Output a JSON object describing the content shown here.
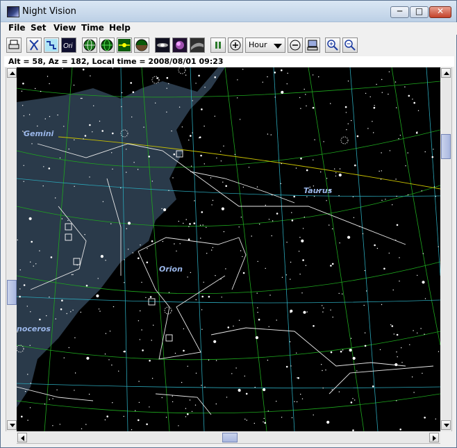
{
  "window": {
    "title": "Night Vision"
  },
  "window_controls": {
    "minimize": "─",
    "maximize": "□",
    "close": "✕"
  },
  "menu": [
    "File",
    "Set",
    "View",
    "Time",
    "Help"
  ],
  "toolbar": {
    "tools": [
      {
        "name": "print-icon"
      },
      {
        "name": "constellation-line-icon"
      },
      {
        "name": "constellation-boundary-icon"
      },
      {
        "name": "constellation-name-icon",
        "label": "Ori"
      },
      {
        "name": "equatorial-grid-icon"
      },
      {
        "name": "altaz-grid-icon"
      },
      {
        "name": "ecliptic-icon"
      },
      {
        "name": "horizon-icon"
      },
      {
        "name": "galaxy-icon"
      },
      {
        "name": "nebula-icon"
      },
      {
        "name": "milky-way-icon"
      },
      {
        "name": "pause-icon"
      },
      {
        "name": "step-forward-icon"
      },
      {
        "name": "step-back-icon"
      },
      {
        "name": "monitor-icon"
      },
      {
        "name": "zoom-in-icon"
      },
      {
        "name": "zoom-out-icon"
      }
    ],
    "time_step": "Hour"
  },
  "status": "Alt = 58, Az = 182, Local time = 2008/08/01 09:23",
  "sky": {
    "constellations": [
      "Gemini",
      "Taurus",
      "Orion",
      "Monoceros"
    ],
    "constellation_display": [
      "Gemini",
      "Taurus",
      "Orion",
      "noceros"
    ]
  },
  "colors": {
    "sky": "#000000",
    "milky_way": "#2a3a4a",
    "equatorial_grid": "#2aa6b8",
    "altaz_grid": "#1ea81e",
    "ecliptic": "#c8c000",
    "constellation_lines": "#e8e8e8",
    "constellation_labels": "#9ab6e8",
    "accent": "#a9b7e0"
  }
}
